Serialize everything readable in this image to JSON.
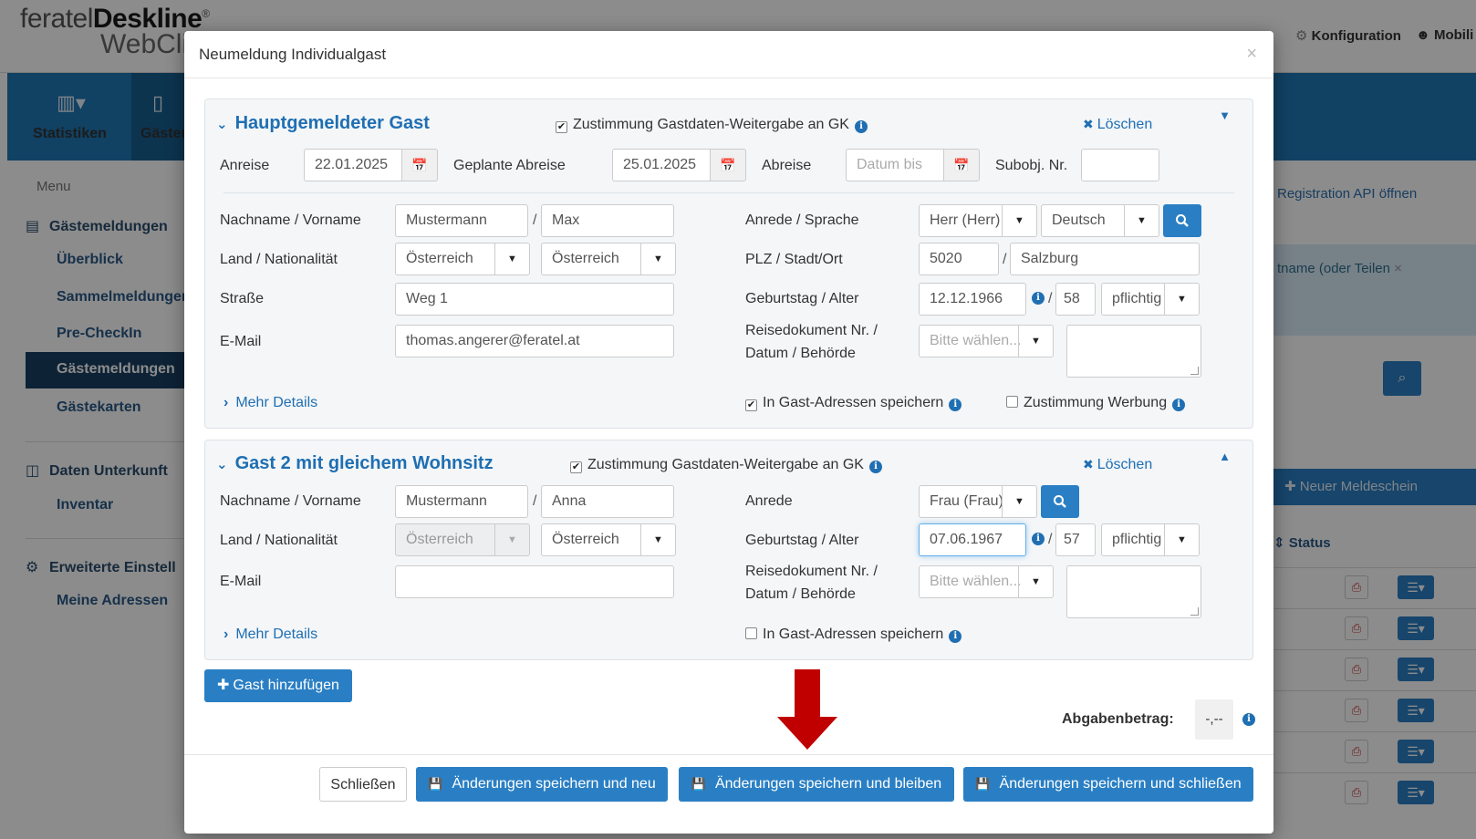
{
  "app": {
    "logo_prefix": "feratel",
    "logo_bold": "Deskline",
    "logo_mark": "®",
    "logo_line2": "WebCli",
    "nav_config": "Konfiguration",
    "nav_mobil": "Mobili"
  },
  "bluebar": {
    "statistiken": "Statistiken",
    "gaeste": "Gästem"
  },
  "sidebar": {
    "menu": "Menu",
    "section1": "Gästemeldungen",
    "items": [
      "Überblick",
      "Sammelmeldungen",
      "Pre-CheckIn",
      "Gästemeldungen",
      "Gästekarten"
    ],
    "section2": "Daten Unterkunft",
    "items2": [
      "Inventar"
    ],
    "section3": "Erweiterte Einstell",
    "items3": [
      "Meine Adressen"
    ]
  },
  "rightbg": {
    "api_link": "Registration API öffnen",
    "alert": "tname (oder Teilen",
    "new_btn": "Neuer Meldeschein",
    "status": "Status"
  },
  "modal": {
    "title": "Neumeldung Individualgast",
    "close": "×"
  },
  "guest1": {
    "title": "Hauptgemeldeter Gast",
    "consent": "Zustimmung Gastdaten-Weitergabe an GK",
    "delete": "Löschen",
    "arrival_label": "Anreise",
    "arrival": "22.01.2025",
    "planned_dep_label": "Geplante Abreise",
    "planned_dep": "25.01.2025",
    "departure_label": "Abreise",
    "departure_placeholder": "Datum bis",
    "subobj_label": "Subobj. Nr.",
    "subobj": "",
    "name_label": "Nachname / Vorname",
    "lastname": "Mustermann",
    "firstname": "Max",
    "country_label": "Land / Nationalität",
    "country": "Österreich",
    "nationality": "Österreich",
    "street_label": "Straße",
    "street": "Weg 1",
    "email_label": "E-Mail",
    "email": "thomas.angerer@feratel.at",
    "salutation_label": "Anrede / Sprache",
    "salutation": "Herr (Herr)",
    "language": "Deutsch",
    "zip_label": "PLZ / Stadt/Ort",
    "zip": "5020",
    "city": "Salzburg",
    "birthday_label": "Geburtstag / Alter",
    "birthday": "12.12.1966",
    "age": "58",
    "duty": "pflichtig",
    "doc_label_1": "Reisedokument Nr. /",
    "doc_label_2": "Datum / Behörde",
    "doc_placeholder": "Bitte wählen...",
    "more": "Mehr Details",
    "save_address": "In Gast-Adressen speichern",
    "ad_consent": "Zustimmung Werbung"
  },
  "guest2": {
    "title": "Gast 2 mit gleichem Wohnsitz",
    "consent": "Zustimmung Gastdaten-Weitergabe an GK",
    "delete": "Löschen",
    "name_label": "Nachname / Vorname",
    "lastname": "Mustermann",
    "firstname": "Anna",
    "country_label": "Land / Nationalität",
    "country": "Österreich",
    "nationality": "Österreich",
    "email_label": "E-Mail",
    "email": "",
    "salutation_label": "Anrede",
    "salutation": "Frau (Frau)",
    "birthday_label": "Geburtstag / Alter",
    "birthday": "07.06.1967",
    "age": "57",
    "duty": "pflichtig",
    "doc_label_1": "Reisedokument Nr. /",
    "doc_label_2": "Datum / Behörde",
    "doc_placeholder": "Bitte wählen...",
    "more": "Mehr Details",
    "save_address": "In Gast-Adressen speichern"
  },
  "actions": {
    "add_guest": "Gast hinzufügen",
    "fee_label": "Abgabenbetrag:",
    "fee_value": "-,--"
  },
  "footer": {
    "close": "Schließen",
    "save_new": "Änderungen speichern und neu",
    "save_stay": "Änderungen speichern und bleiben",
    "save_close": "Änderungen speichern und schließen"
  },
  "colors": {
    "primary": "#2a7fc4",
    "brand_blue": "#1f77b4",
    "arrow_red": "#c00000",
    "title_blue": "#1f6fb2"
  }
}
